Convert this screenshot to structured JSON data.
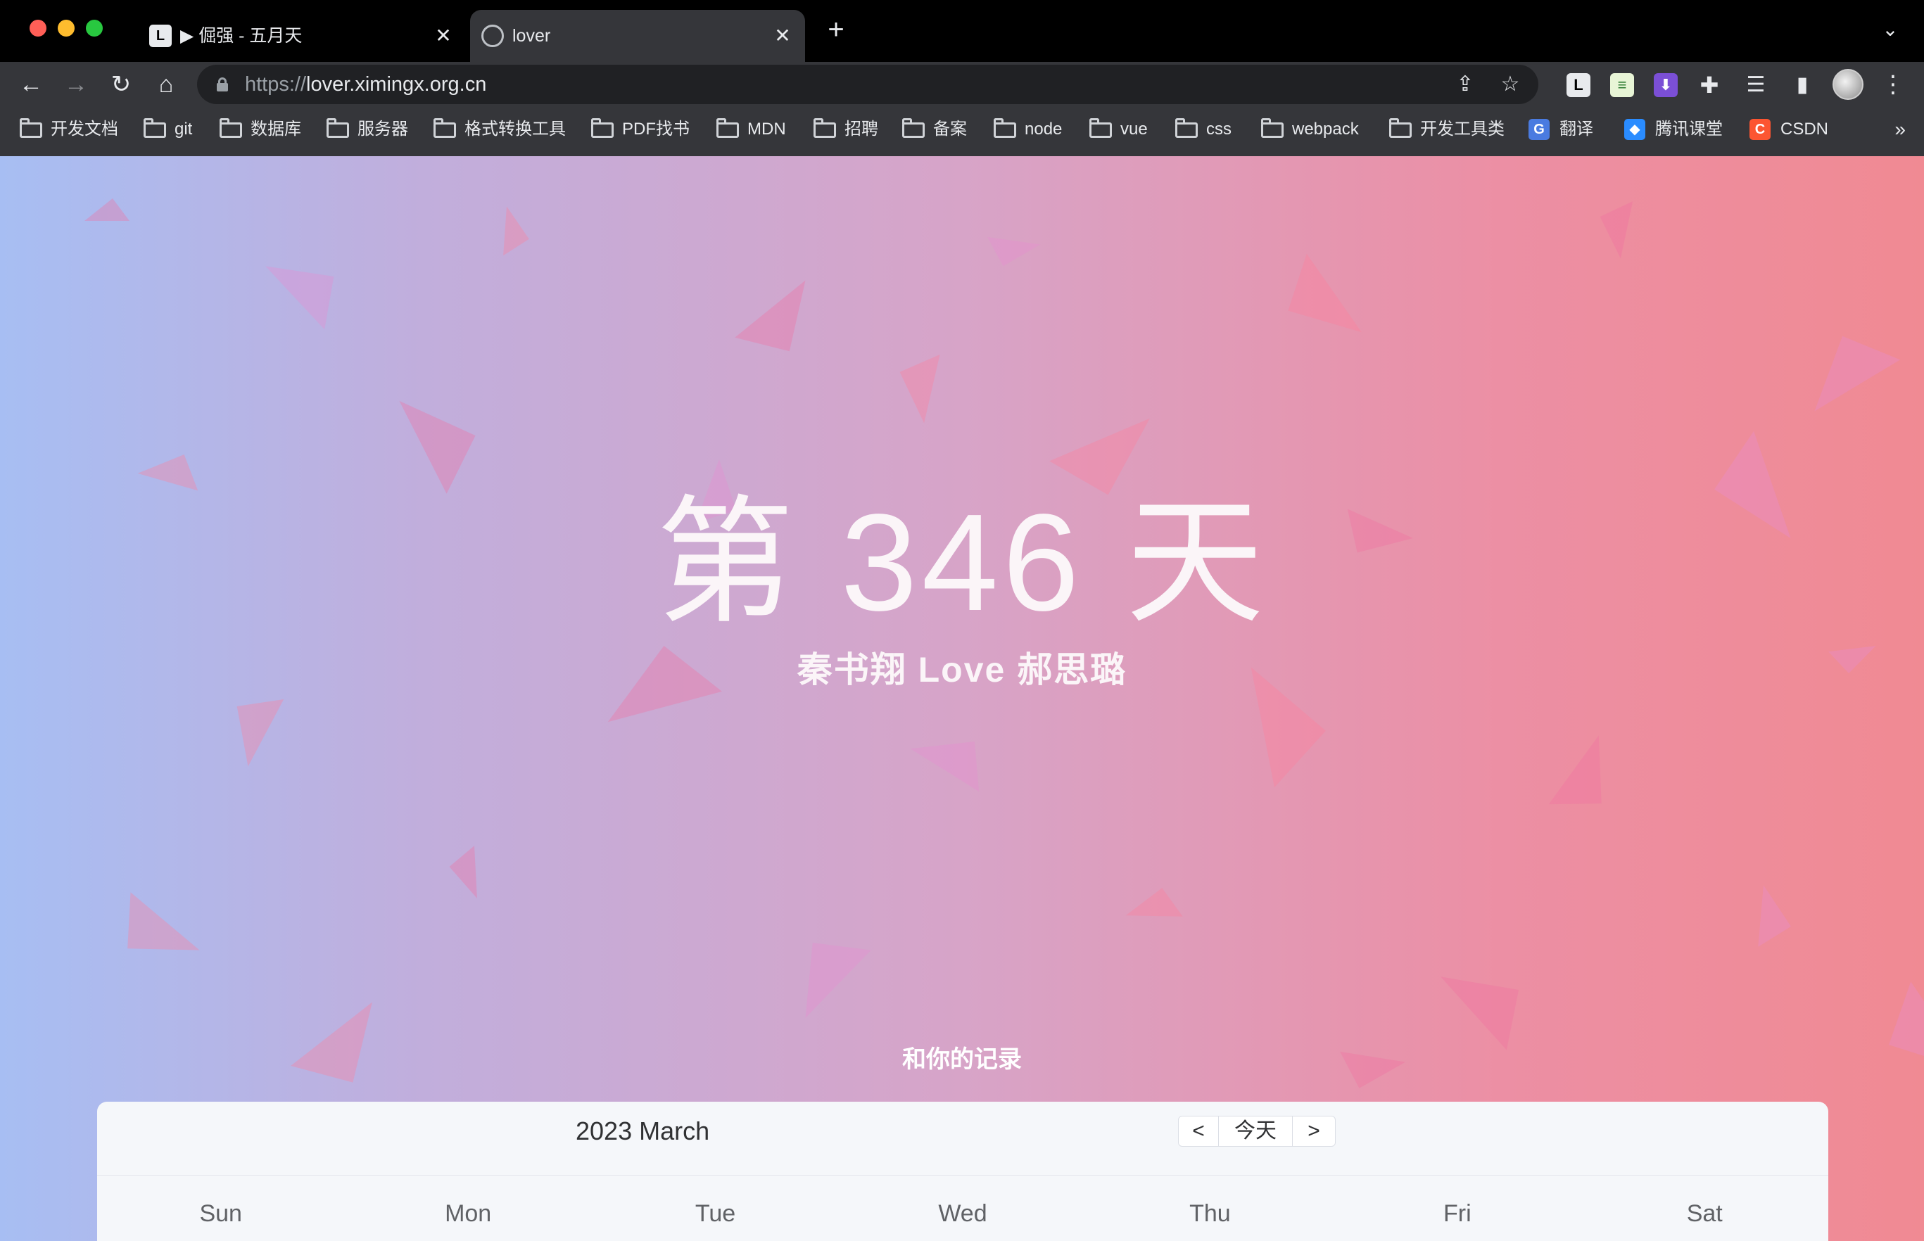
{
  "browser": {
    "tabs": [
      {
        "title": "▶ 倔强 - 五月天",
        "favicon": "L",
        "close": "✕"
      },
      {
        "title": "lover",
        "close": "✕"
      }
    ],
    "new_tab": "+",
    "tab_list": "⌄",
    "nav": {
      "back": "←",
      "forward": "→",
      "reload": "↻",
      "home": "⌂"
    },
    "url": {
      "protocol": "https://",
      "host": "lover.ximingx.org.cn"
    },
    "omnibox_icons": {
      "share": "⇪",
      "bookmark_star": "☆"
    },
    "extensions": {
      "l_ext": "L",
      "sheet_ext": "≡",
      "shield_ext": "⬇",
      "puzzle": "✚",
      "reading_list": "☰",
      "side_panel": "▮"
    },
    "menu": "⋮",
    "bookmarks": [
      {
        "label": "开发文档",
        "type": "folder"
      },
      {
        "label": "git",
        "type": "folder"
      },
      {
        "label": "数据库",
        "type": "folder"
      },
      {
        "label": "服务器",
        "type": "folder"
      },
      {
        "label": "格式转换工具",
        "type": "folder"
      },
      {
        "label": "PDF找书",
        "type": "folder"
      },
      {
        "label": "MDN",
        "type": "folder"
      },
      {
        "label": "招聘",
        "type": "folder"
      },
      {
        "label": "备案",
        "type": "folder"
      },
      {
        "label": "node",
        "type": "folder"
      },
      {
        "label": "vue",
        "type": "folder"
      },
      {
        "label": "css",
        "type": "folder"
      },
      {
        "label": "webpack",
        "type": "folder"
      },
      {
        "label": "开发工具类",
        "type": "folder"
      },
      {
        "label": "翻译",
        "type": "site",
        "icon": "G",
        "color": "#4a7be0"
      },
      {
        "label": "腾讯课堂",
        "type": "site",
        "icon": "◆",
        "color": "#2a8cff"
      },
      {
        "label": "CSDN",
        "type": "site",
        "icon": "C",
        "color": "#fc5531"
      }
    ],
    "bookmarks_more": "»"
  },
  "page": {
    "hero": "第 346 天",
    "couple": "秦书翔 Love 郝思璐",
    "record_title": "和你的记录",
    "calendar": {
      "title": "2023 March",
      "prev": "<",
      "today": "今天",
      "next": ">",
      "weekdays": [
        "Sun",
        "Mon",
        "Tue",
        "Wed",
        "Thu",
        "Fri",
        "Sat"
      ]
    }
  }
}
